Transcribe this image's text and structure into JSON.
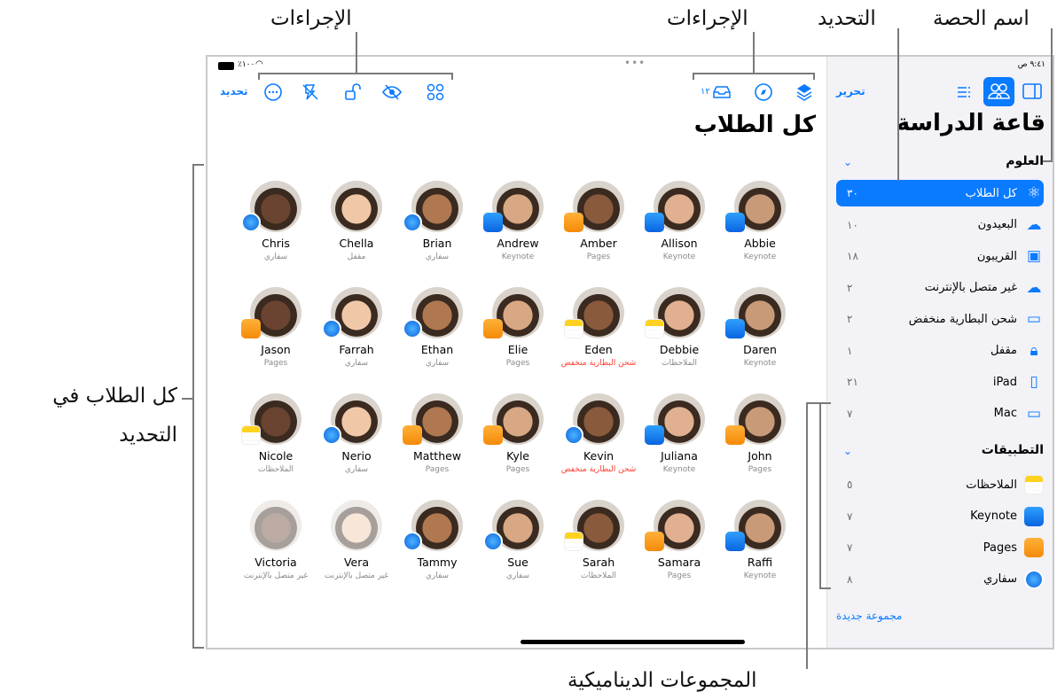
{
  "callouts": {
    "actions_left": "الإجراءات",
    "actions_right": "الإجراءات",
    "selection": "التحديد",
    "class_name": "اسم الحصة",
    "all_students_line1": "كل الطلاب في",
    "all_students_line2": "التحديد",
    "dynamic_groups": "المجموعات الديناميكية"
  },
  "status_bar": {
    "battery": "٪١٠٠",
    "time": "٩:٤١ ص"
  },
  "toolbar": {
    "select_label": "تحديد",
    "left_icons": [
      "more-icon",
      "hide-screen-icon",
      "unlock-icon",
      "eye-slash-icon",
      "grid-icon"
    ],
    "right_icons": [
      "inbox-icon",
      "compass-icon",
      "layers-icon"
    ],
    "inbox_count": "١٢"
  },
  "main": {
    "title": "كل الطلاب"
  },
  "students": [
    [
      {
        "name": "Abbie",
        "app": "Keynote",
        "badge": "keynote"
      },
      {
        "name": "Allison",
        "app": "Keynote",
        "badge": "keynote"
      },
      {
        "name": "Amber",
        "app": "Pages",
        "badge": "pages"
      },
      {
        "name": "Andrew",
        "app": "Keynote",
        "badge": "keynote"
      },
      {
        "name": "Brian",
        "app": "سفاري",
        "badge": "safari"
      },
      {
        "name": "Chella",
        "app": "مقفل",
        "badge": ""
      },
      {
        "name": "Chris",
        "app": "سفاري",
        "badge": "safari"
      }
    ],
    [
      {
        "name": "Daren",
        "app": "Keynote",
        "badge": "keynote"
      },
      {
        "name": "Debbie",
        "app": "الملاحظات",
        "badge": "notes"
      },
      {
        "name": "Eden",
        "app": "شحن البطارية منخفض",
        "badge": "notes",
        "warn": true
      },
      {
        "name": "Elie",
        "app": "Pages",
        "badge": "pages"
      },
      {
        "name": "Ethan",
        "app": "سفاري",
        "badge": "safari"
      },
      {
        "name": "Farrah",
        "app": "سفاري",
        "badge": "safari"
      },
      {
        "name": "Jason",
        "app": "Pages",
        "badge": "pages"
      }
    ],
    [
      {
        "name": "John",
        "app": "Pages",
        "badge": "pages"
      },
      {
        "name": "Juliana",
        "app": "Keynote",
        "badge": "keynote"
      },
      {
        "name": "Kevin",
        "app": "شحن البطارية منخفض",
        "badge": "safari",
        "warn": true
      },
      {
        "name": "Kyle",
        "app": "Pages",
        "badge": "pages"
      },
      {
        "name": "Matthew",
        "app": "Pages",
        "badge": "pages"
      },
      {
        "name": "Nerio",
        "app": "سفاري",
        "badge": "safari"
      },
      {
        "name": "Nicole",
        "app": "الملاحظات",
        "badge": "notes"
      }
    ],
    [
      {
        "name": "Raffi",
        "app": "Keynote",
        "badge": "keynote"
      },
      {
        "name": "Samara",
        "app": "Pages",
        "badge": "pages"
      },
      {
        "name": "Sarah",
        "app": "الملاحظات",
        "badge": "notes"
      },
      {
        "name": "Sue",
        "app": "سفاري",
        "badge": "safari"
      },
      {
        "name": "Tammy",
        "app": "سفاري",
        "badge": "safari"
      },
      {
        "name": "Vera",
        "app": "غير متصل بالإنترنت",
        "badge": "",
        "offline": true
      },
      {
        "name": "Victoria",
        "app": "غير متصل بالإنترنت",
        "badge": "",
        "offline": true
      }
    ]
  ],
  "sidebar": {
    "edit_label": "تحرير",
    "title": "قاعة الدراسة",
    "class_section": "العلوم",
    "groups": [
      {
        "label": "كل الطلاب",
        "count": "٣٠",
        "icon": "atom-icon",
        "selected": true
      },
      {
        "label": "البعيدون",
        "count": "١٠",
        "icon": "remote-cloud-icon"
      },
      {
        "label": "القريبون",
        "count": "١٨",
        "icon": "nearby-person-icon"
      },
      {
        "label": "غير متصل بالإنترنت",
        "count": "٢",
        "icon": "offline-cloud-icon"
      },
      {
        "label": "شحن البطارية منخفض",
        "count": "٢",
        "icon": "low-battery-icon"
      },
      {
        "label": "مقفل",
        "count": "١",
        "icon": "lock-icon"
      },
      {
        "label": "iPad",
        "count": "٢١",
        "icon": "ipad-icon"
      },
      {
        "label": "Mac",
        "count": "٧",
        "icon": "laptop-icon"
      }
    ],
    "apps_section": "التطبيقات",
    "apps": [
      {
        "label": "الملاحظات",
        "count": "٥",
        "icon": "notes"
      },
      {
        "label": "Keynote",
        "count": "٧",
        "icon": "keynote"
      },
      {
        "label": "Pages",
        "count": "٧",
        "icon": "pages"
      },
      {
        "label": "سفاري",
        "count": "٨",
        "icon": "safari"
      }
    ],
    "new_group": "مجموعة جديدة"
  },
  "colors": {
    "accent": "#0a7aff",
    "warning": "#ff3b30",
    "sidebar_bg": "#f2f2f7"
  }
}
